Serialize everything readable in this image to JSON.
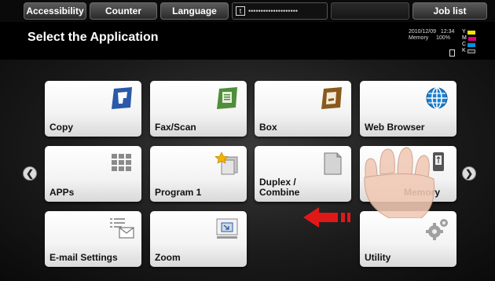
{
  "topbar": {
    "accessibility": "Accessibility",
    "counter": "Counter",
    "language": "Language",
    "status_text": "••••••••••••••••••••",
    "job_list": "Job list"
  },
  "header": {
    "title": "Select the Application",
    "date": "2010/12/09",
    "time": "12:34",
    "memory_label": "Memory",
    "memory_value": "100%",
    "toner": [
      {
        "label": "Y",
        "color": "#f2e600"
      },
      {
        "label": "M",
        "color": "#e0007a"
      },
      {
        "label": "C",
        "color": "#0091e0"
      },
      {
        "label": "K",
        "color": "#222222"
      }
    ]
  },
  "apps": {
    "copy": "Copy",
    "fax_scan": "Fax/Scan",
    "box": "Box",
    "web_browser": "Web Browser",
    "apps": "APPs",
    "program1": "Program 1",
    "duplex_line1": "Duplex /",
    "duplex_line2": "Combine",
    "memory": "Memory",
    "email_settings": "E-mail Settings",
    "zoom": "Zoom",
    "utility": "Utility"
  },
  "colors": {
    "swipe_arrow": "#e01818",
    "icon_blue": "#2a5aa8",
    "icon_green": "#4f8f3a",
    "icon_brown": "#8a5a1c"
  }
}
